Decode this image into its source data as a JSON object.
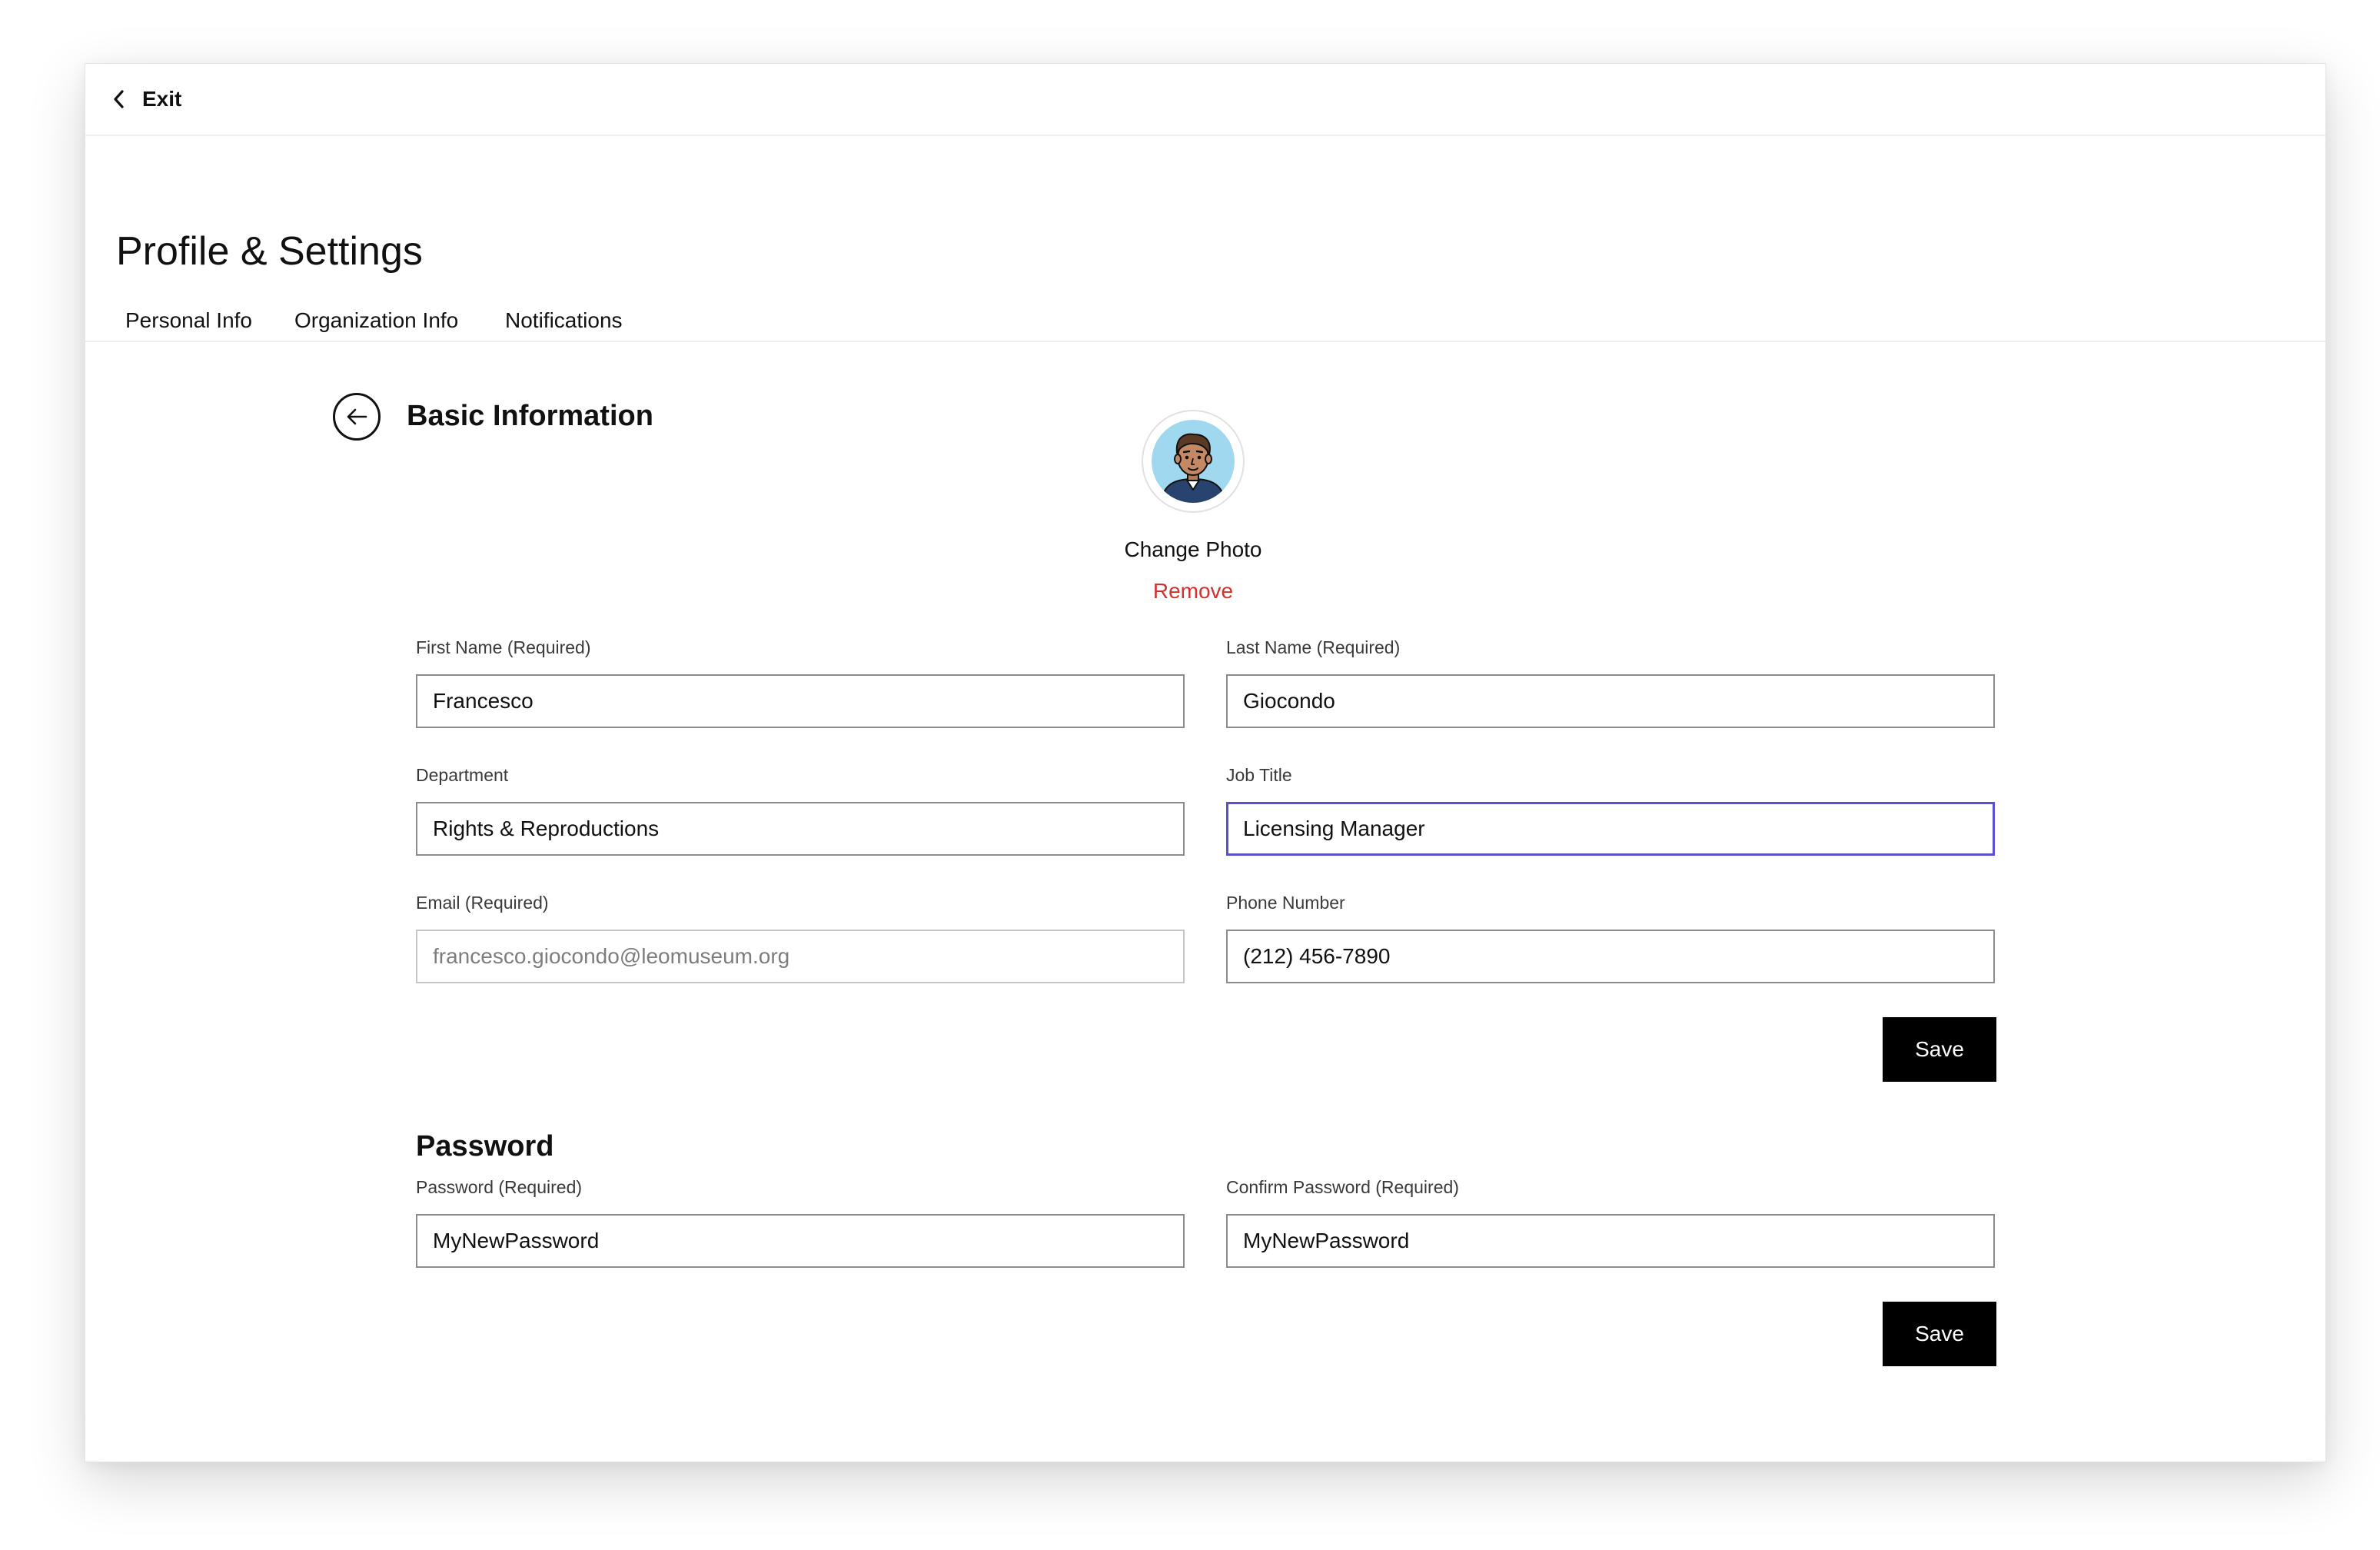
{
  "topbar": {
    "exit_label": "Exit"
  },
  "page": {
    "title": "Profile & Settings"
  },
  "tabs": [
    {
      "label": "Personal Info"
    },
    {
      "label": "Organization Info"
    },
    {
      "label": "Notifications"
    }
  ],
  "basic_info": {
    "title": "Basic Information",
    "change_photo_label": "Change Photo",
    "remove_label": "Remove",
    "fields": {
      "first_name": {
        "label": "First Name (Required)",
        "value": "Francesco"
      },
      "last_name": {
        "label": "Last Name (Required)",
        "value": "Giocondo"
      },
      "department": {
        "label": "Department",
        "value": "Rights & Reproductions"
      },
      "job_title": {
        "label": "Job Title",
        "value": "Licensing Manager"
      },
      "email": {
        "label": "Email (Required)",
        "value": "francesco.giocondo@leomuseum.org"
      },
      "phone": {
        "label": "Phone Number",
        "value": "(212) 456-7890"
      }
    },
    "save_label": "Save"
  },
  "password": {
    "title": "Password",
    "fields": {
      "password": {
        "label": "Password (Required)",
        "value": "MyNewPassword"
      },
      "confirm": {
        "label": "Confirm Password (Required)",
        "value": "MyNewPassword"
      }
    },
    "save_label": "Save"
  },
  "colors": {
    "focus_border": "#5a4fcf",
    "remove_link": "#d0322f",
    "button_bg": "#000000",
    "avatar_bg": "#9fd8ef"
  },
  "icons": {
    "exit": "chevron-left-icon",
    "back": "arrow-left-icon",
    "avatar": "user-avatar-illustration"
  }
}
